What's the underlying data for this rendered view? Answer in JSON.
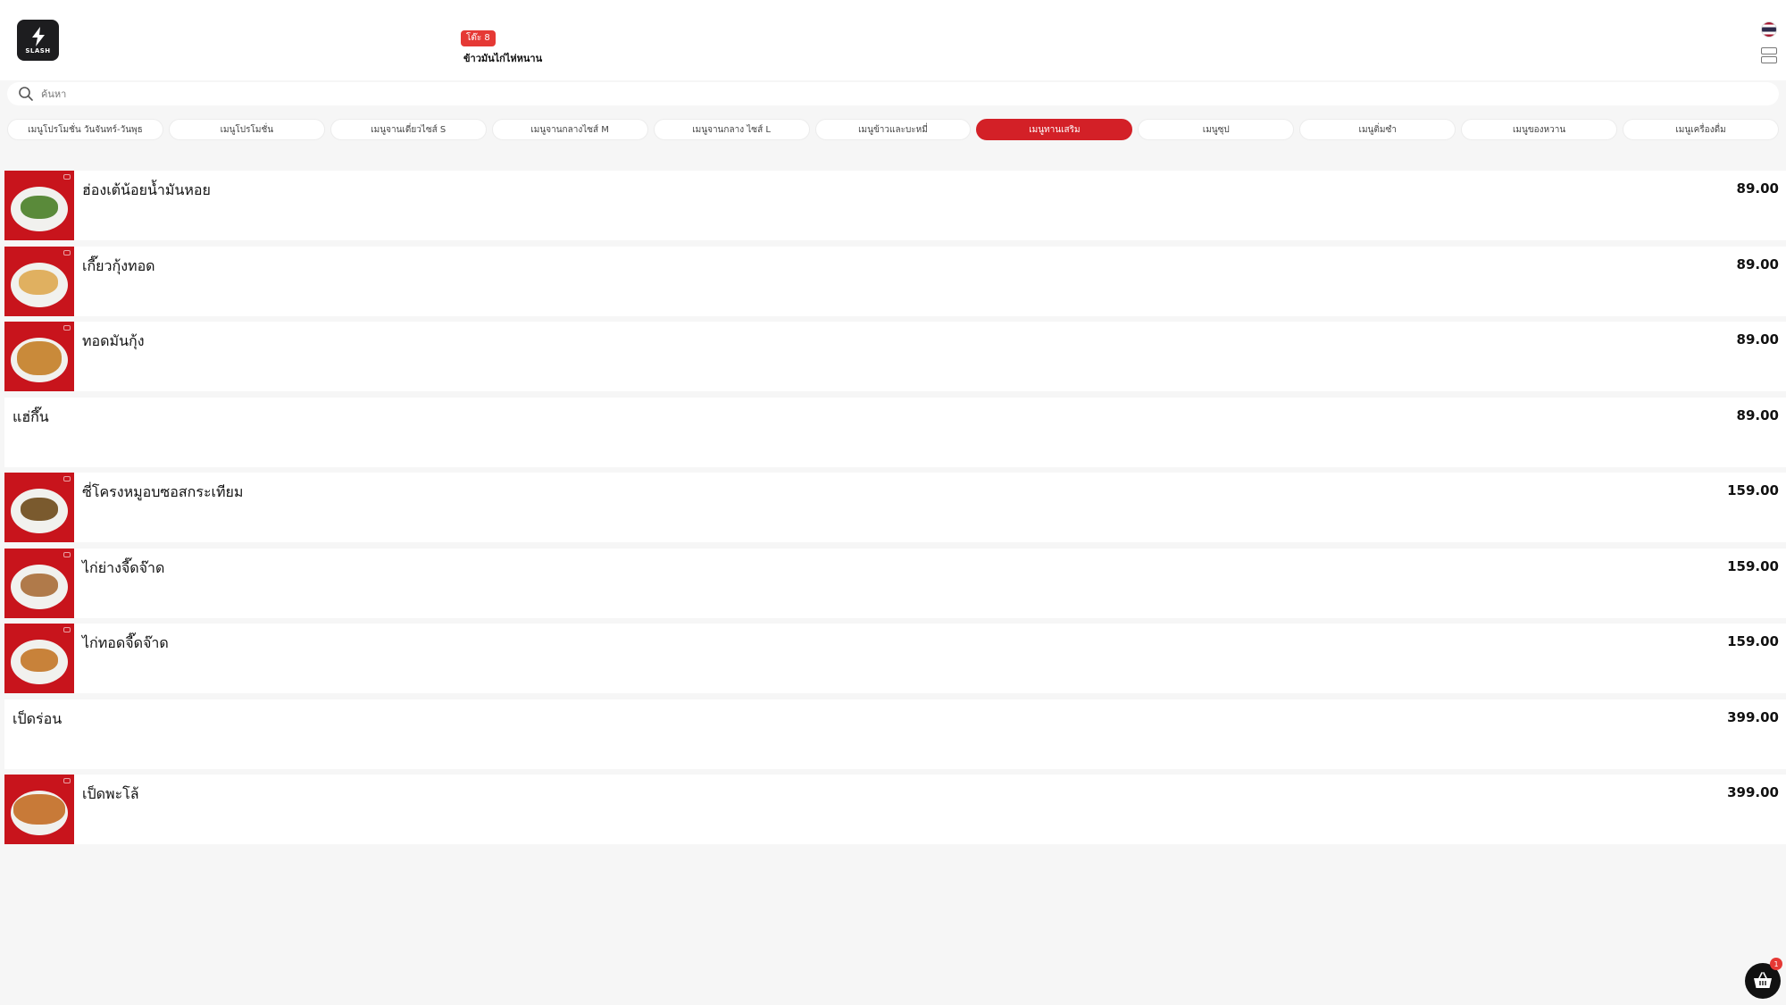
{
  "brand": {
    "logo_text": "SLASH"
  },
  "header": {
    "table_label": "โต๊ะ 8",
    "shop_name": "ข้าวมันไก่ไห่หนาน"
  },
  "search": {
    "placeholder": "ค้นหา"
  },
  "categories": [
    {
      "label": "เมนูโปรโมชั่น วันจันทร์-วันพุธ",
      "active": false
    },
    {
      "label": "เมนูโปรโมชั่น",
      "active": false
    },
    {
      "label": "เมนูจานเดี่ยวไซส์ S",
      "active": false
    },
    {
      "label": "เมนูจานกลางไซส์ M",
      "active": false
    },
    {
      "label": "เมนูจานกลาง ไซส์ L",
      "active": false
    },
    {
      "label": "เมนูข้าวและบะหมี่",
      "active": false
    },
    {
      "label": "เมนูทานเสริม",
      "active": true
    },
    {
      "label": "เมนูซุป",
      "active": false
    },
    {
      "label": "เมนูติ่มซำ",
      "active": false
    },
    {
      "label": "เมนูของหวาน",
      "active": false
    },
    {
      "label": "เมนูเครื่องดื่ม",
      "active": false
    }
  ],
  "menu_items": [
    {
      "name": "ฮ่องเต้น้อยน้ำมันหอย",
      "price": "89.00",
      "has_image": true
    },
    {
      "name": "เกี๊ยวกุ้งทอด",
      "price": "89.00",
      "has_image": true
    },
    {
      "name": "ทอดมันกุ้ง",
      "price": "89.00",
      "has_image": true
    },
    {
      "name": "แฮ่กึ๊น",
      "price": "89.00",
      "has_image": false
    },
    {
      "name": "ซี่โครงหมูอบซอสกระเทียม",
      "price": "159.00",
      "has_image": true
    },
    {
      "name": "ไก่ย่างจี๊ดจ๊าด",
      "price": "159.00",
      "has_image": true
    },
    {
      "name": "ไก่ทอดจี๊ดจ๊าด",
      "price": "159.00",
      "has_image": true
    },
    {
      "name": "เป็ดร่อน",
      "price": "399.00",
      "has_image": false
    },
    {
      "name": "เป็ดพะโล้",
      "price": "399.00",
      "has_image": true
    }
  ],
  "cart": {
    "count": "1"
  },
  "colors": {
    "accent": "#d32027",
    "thumb_bg": "#c8141c"
  }
}
